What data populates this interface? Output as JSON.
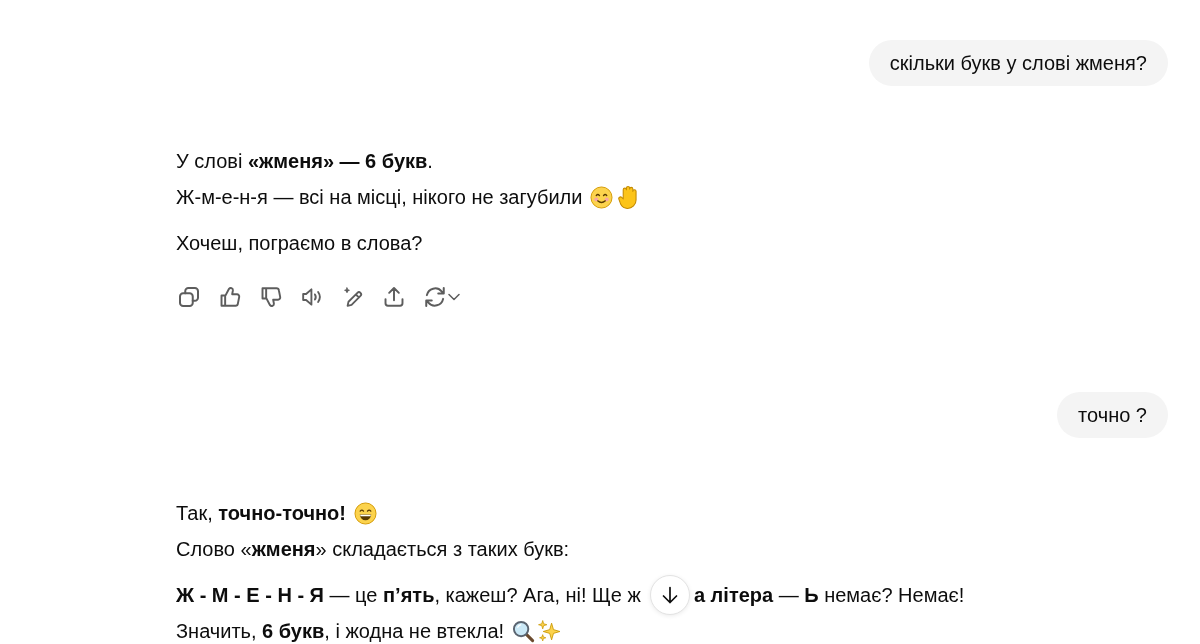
{
  "conversation": [
    {
      "kind": "user",
      "text": "скільки букв у слові жменя?"
    },
    {
      "kind": "assistant",
      "paragraphs": [
        {
          "lines": [
            {
              "parts": [
                "У слові **«жменя» — 6 букв**."
              ]
            },
            {
              "parts": [
                "Ж-м-е-н-я — всі на місці, нікого не загубили"
              ]
            }
          ]
        },
        {
          "lines": [
            {
              "parts": [
                "Хочеш, пограємо в слова?"
              ]
            }
          ]
        }
      ],
      "action_bar": true
    },
    {
      "kind": "user",
      "text": "точно ?"
    },
    {
      "kind": "assistant",
      "paragraphs": [
        {
          "lines": [
            {
              "parts": [
                "Так, **точно-точно!**"
              ]
            },
            {
              "parts": [
                "Слово «**жменя**» складається з таких букв:"
              ]
            }
          ]
        },
        {
          "lines": [
            {
              "parts": [
                "**Ж - М - Е - Н - Я** — це **п’ять**, кажеш? Ага, ні! Ще ж",
                "**а літера** — **Ь** немає? Немає!"
              ]
            },
            {
              "parts": [
                "Значить, **6 букв**, і жодна не втекла!"
              ]
            }
          ]
        }
      ]
    }
  ]
}
